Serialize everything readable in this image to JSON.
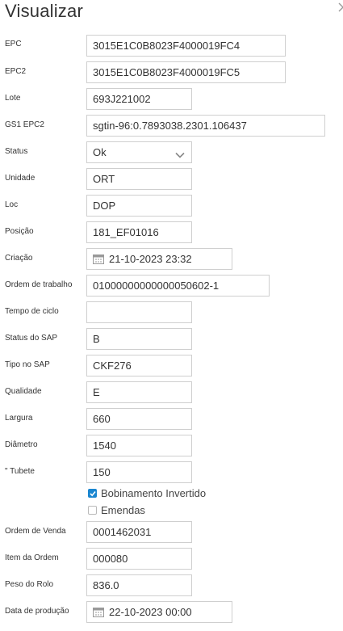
{
  "title": "Visualizar",
  "close_icon": "close-icon",
  "fields": {
    "epc": {
      "label": "EPC",
      "value": "3015E1C0B8023F4000019FC4"
    },
    "epc2": {
      "label": "EPC2",
      "value": "3015E1C0B8023F4000019FC5"
    },
    "lote": {
      "label": "Lote",
      "value": "693J221002"
    },
    "gs1_epc2": {
      "label": "GS1 EPC2",
      "value": "sgtin-96:0.7893038.2301.106437"
    },
    "status": {
      "label": "Status",
      "value": "Ok"
    },
    "unidade": {
      "label": "Unidade",
      "value": "ORT"
    },
    "loc": {
      "label": "Loc",
      "value": "DOP"
    },
    "posicao": {
      "label": "Posição",
      "value": "181_EF01016"
    },
    "criacao": {
      "label": "Criação",
      "value": "21-10-2023 23:32"
    },
    "ordem_trabalho": {
      "label": "Ordem de trabalho",
      "value": "01000000000000050602-1"
    },
    "tempo_ciclo": {
      "label": "Tempo de ciclo",
      "value": ""
    },
    "status_sap": {
      "label": "Status do SAP",
      "value": "B"
    },
    "tipo_sap": {
      "label": "Tipo no SAP",
      "value": "CKF276"
    },
    "qualidade": {
      "label": "Qualidade",
      "value": "E"
    },
    "largura": {
      "label": "Largura",
      "value": "660"
    },
    "diametro": {
      "label": "Diâmetro",
      "value": "1540"
    },
    "tubete": {
      "label": "\" Tubete",
      "value": "150"
    },
    "ordem_venda": {
      "label": "Ordem de Venda",
      "value": "0001462031"
    },
    "item_ordem": {
      "label": "Item da Ordem",
      "value": "000080"
    },
    "peso_rolo": {
      "label": "Peso do Rolo",
      "value": "836.0"
    },
    "data_producao": {
      "label": "Data de produção",
      "value": "22-10-2023 00:00"
    }
  },
  "checkboxes": {
    "bobinamento": {
      "label": "Bobinamento Invertido",
      "checked": true
    },
    "emendas": {
      "label": "Emendas",
      "checked": false
    }
  },
  "colors": {
    "accent": "#1a86d0",
    "border": "#cfcfcf"
  }
}
